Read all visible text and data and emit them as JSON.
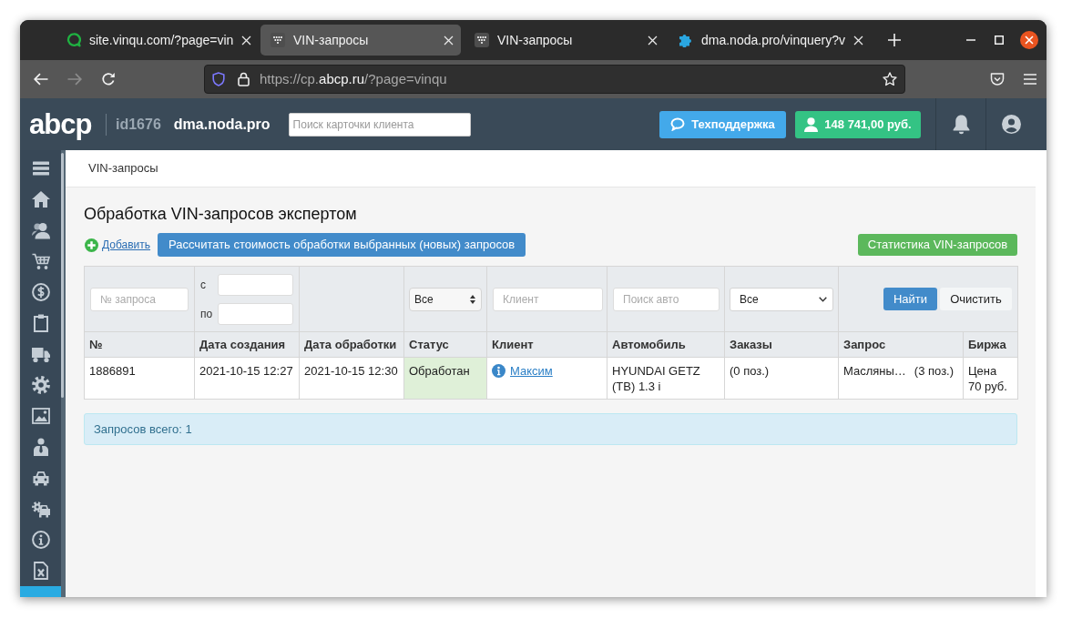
{
  "browser": {
    "tabs": [
      {
        "kind": "vinqu",
        "title": "site.vinqu.com/?page=vin",
        "selected": false
      },
      {
        "kind": "grid",
        "title": "VIN-запросы",
        "selected": true
      },
      {
        "kind": "grid",
        "title": "VIN-запросы",
        "selected": false
      },
      {
        "kind": "puzzle",
        "title": "dma.noda.pro/vinquery?v",
        "selected": false
      }
    ],
    "nav_buttons": [
      {
        "kind": "back",
        "disabled": false
      },
      {
        "kind": "forward",
        "disabled": true
      },
      {
        "kind": "reload",
        "disabled": false
      }
    ],
    "address": {
      "before": "https://cp.",
      "domain": "abcp.ru",
      "after": "/?page=vinqu"
    }
  },
  "header": {
    "logo": "abcp",
    "account_id": "id1676",
    "site": "dma.noda.pro",
    "search": {
      "placeholder": "Поиск карточки клиента"
    },
    "support_button": "Техподдержка",
    "balance_button": "148 741,00 руб."
  },
  "sidebar": {
    "items": [
      {
        "kind": "menu",
        "selected": false
      },
      {
        "kind": "home",
        "selected": false
      },
      {
        "kind": "clients",
        "selected": false
      },
      {
        "kind": "cart",
        "selected": false
      },
      {
        "kind": "finance",
        "selected": false
      },
      {
        "kind": "clipboard",
        "selected": false
      },
      {
        "kind": "delivery",
        "selected": false
      },
      {
        "kind": "settings",
        "selected": false
      },
      {
        "kind": "images",
        "selected": false
      },
      {
        "kind": "manager",
        "selected": false
      },
      {
        "kind": "car",
        "selected": false
      },
      {
        "kind": "parts",
        "selected": false
      },
      {
        "kind": "info",
        "selected": false
      },
      {
        "kind": "excel",
        "selected": false
      },
      {
        "kind": "vin",
        "selected": true
      }
    ]
  },
  "breadcrumb": "VIN-запросы",
  "page": {
    "title": "Обработка VIN-запросов экспертом",
    "add_link": "Добавить",
    "calc_button": "Рассчитать стоимость обработки выбранных (новых) запросов",
    "stats_button": "Статистика VIN-запросов"
  },
  "filters": {
    "request_number": {
      "placeholder": "№ запроса"
    },
    "date_from": {
      "label": "с"
    },
    "date_to": {
      "label": "по"
    },
    "status": {
      "value": "Все"
    },
    "client": {
      "placeholder": "Клиент"
    },
    "car": {
      "placeholder": "Поиск авто"
    },
    "orders": {
      "value": "Все"
    },
    "buttons": [
      {
        "label": "Найти",
        "kind": "primary"
      },
      {
        "label": "Очистить",
        "kind": "default"
      }
    ]
  },
  "table": {
    "columns": [
      "№",
      "Дата создания",
      "Дата обработки",
      "Статус",
      "Клиент",
      "Автомобиль",
      "Заказы",
      "Запрос",
      "Биржа"
    ],
    "rows": [
      {
        "number": "1886891",
        "created": "2021-10-15 12:27",
        "processed": "2021-10-15 12:30",
        "status": {
          "text": "Обработан",
          "color": "#dff0d8"
        },
        "client": "Максим",
        "car": "HYUNDAI GETZ (TB) 1.3 i",
        "orders": "(0 поз.)",
        "request": "Масляны…",
        "request_count": "(3 поз.)",
        "exchange": "Цена 70 руб."
      }
    ]
  },
  "summary": "Запросов всего: 1"
}
